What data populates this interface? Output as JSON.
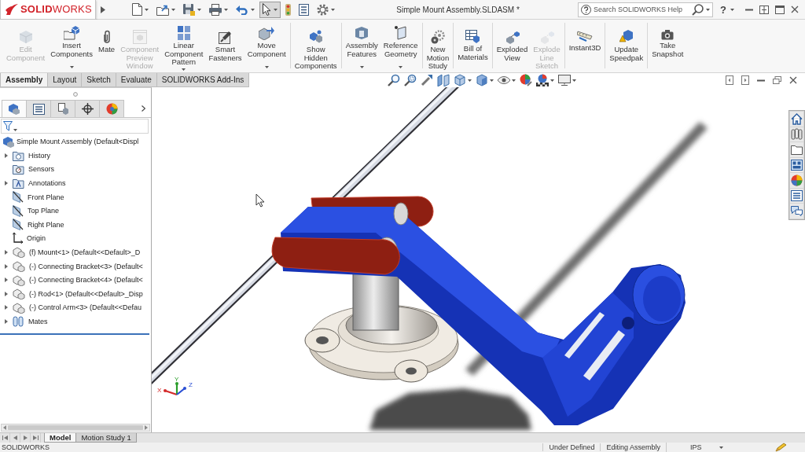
{
  "title_bar": {
    "logo": "**SOLID**WORKS",
    "quick_access": [
      {
        "dropdown": true,
        "selected": false
      },
      {
        "dropdown": true,
        "selected": false
      },
      {
        "dropdown": true,
        "selected": false
      },
      {
        "dropdown": true,
        "selected": false
      },
      {
        "dropdown": true,
        "selected": false
      },
      {
        "dropdown": true,
        "selected": true
      },
      {
        "dropdown": false,
        "selected": false
      },
      {
        "dropdown": false,
        "selected": false
      },
      {
        "dropdown": true,
        "selected": false
      }
    ],
    "title": "Simple Mount Assembly.SLDASM *",
    "search": {
      "placeholder": "Search SOLIDWORKS Help"
    },
    "help_menu": {
      "label": "?"
    }
  },
  "ribbon": {
    "groups": [
      {
        "buttons": [
          {
            "lines": [
              "Edit",
              "Component"
            ],
            "disabled": true,
            "dropdown": false
          },
          {
            "lines": [
              "Insert",
              "Components"
            ],
            "disabled": false,
            "dropdown": true
          },
          {
            "lines": [
              "Mate"
            ],
            "disabled": false,
            "dropdown": false
          },
          {
            "lines": [
              "Component",
              "Preview",
              "Window"
            ],
            "disabled": true,
            "dropdown": false
          },
          {
            "lines": [
              "Linear",
              "Component",
              "Pattern"
            ],
            "disabled": false,
            "dropdown": true
          },
          {
            "lines": [
              "Smart",
              "Fasteners"
            ],
            "disabled": false,
            "dropdown": false
          },
          {
            "lines": [
              "Move",
              "Component"
            ],
            "disabled": false,
            "dropdown": true
          }
        ]
      },
      {
        "buttons": [
          {
            "lines": [
              "Show",
              "Hidden",
              "Components"
            ],
            "disabled": false,
            "dropdown": false
          }
        ]
      },
      {
        "buttons": [
          {
            "lines": [
              "Assembly",
              "Features"
            ],
            "disabled": false,
            "dropdown": true
          },
          {
            "lines": [
              "Reference",
              "Geometry"
            ],
            "disabled": false,
            "dropdown": true
          }
        ]
      },
      {
        "buttons": [
          {
            "lines": [
              "New",
              "Motion",
              "Study"
            ],
            "disabled": false,
            "dropdown": false
          }
        ]
      },
      {
        "buttons": [
          {
            "lines": [
              "Bill of",
              "Materials"
            ],
            "disabled": false,
            "dropdown": false
          }
        ]
      },
      {
        "buttons": [
          {
            "lines": [
              "Exploded",
              "View"
            ],
            "disabled": false,
            "dropdown": false
          },
          {
            "lines": [
              "Explode",
              "Line",
              "Sketch"
            ],
            "disabled": true,
            "dropdown": false
          }
        ]
      },
      {
        "buttons": [
          {
            "lines": [
              "Instant3D"
            ],
            "disabled": false,
            "dropdown": false
          }
        ]
      },
      {
        "buttons": [
          {
            "lines": [
              "Update",
              "Speedpak"
            ],
            "disabled": false,
            "dropdown": false
          }
        ]
      },
      {
        "buttons": [
          {
            "lines": [
              "Take",
              "Snapshot"
            ],
            "disabled": false,
            "dropdown": false
          }
        ]
      }
    ]
  },
  "command_tabs": [
    {
      "label": "Assembly",
      "selected": true
    },
    {
      "label": "Layout",
      "selected": false
    },
    {
      "label": "Sketch",
      "selected": false
    },
    {
      "label": "Evaluate",
      "selected": false
    },
    {
      "label": "SOLIDWORKS Add-Ins",
      "selected": false
    }
  ],
  "view_toolbar": [
    {
      "dropdown": false
    },
    {
      "dropdown": false
    },
    {
      "dropdown": false
    },
    {
      "dropdown": false
    },
    {
      "dropdown": true
    },
    {
      "dropdown": true
    },
    {
      "dropdown": true
    },
    {
      "dropdown": false
    },
    {
      "dropdown": true
    },
    {
      "dropdown": true
    }
  ],
  "feature_manager": {
    "tabs": [
      {
        "selected": true
      },
      {
        "selected": false
      },
      {
        "selected": false
      },
      {
        "selected": false
      },
      {
        "selected": false
      }
    ],
    "tree": {
      "label": "Simple Mount Assembly (Default<Displ",
      "children": [
        {
          "label": "History",
          "kind": "history",
          "expandable": true
        },
        {
          "label": "Sensors",
          "kind": "sensors",
          "expandable": false
        },
        {
          "label": "Annotations",
          "kind": "annotations",
          "expandable": true
        },
        {
          "label": "Front Plane",
          "kind": "plane",
          "expandable": false
        },
        {
          "label": "Top Plane",
          "kind": "plane",
          "expandable": false
        },
        {
          "label": "Right Plane",
          "kind": "plane",
          "expandable": false
        },
        {
          "label": "Origin",
          "kind": "origin",
          "expandable": false
        },
        {
          "label": "(f) Mount<1> (Default<<Default>_D",
          "kind": "component",
          "expandable": true
        },
        {
          "label": "(-) Connecting Bracket<3> (Default<",
          "kind": "component",
          "expandable": true
        },
        {
          "label": "(-) Connecting Bracket<4> (Default<",
          "kind": "component",
          "expandable": true
        },
        {
          "label": "(-) Rod<1> (Default<<Default>_Disp",
          "kind": "component",
          "expandable": true
        },
        {
          "label": "(-) Control Arm<3> (Default<<Defau",
          "kind": "component",
          "expandable": true
        },
        {
          "label": "Mates",
          "kind": "mates",
          "expandable": true
        }
      ]
    }
  },
  "graphics": {
    "triad": [
      {
        "label": "X",
        "color": "#d42a2a"
      },
      {
        "label": "Y",
        "color": "#2a9d2a"
      },
      {
        "label": "Z",
        "color": "#2a4fd4"
      }
    ]
  },
  "bottom_tabs": [
    {
      "label": "Model",
      "selected": true
    },
    {
      "label": "Motion Study 1",
      "selected": false
    }
  ],
  "status_bar": {
    "app": "SOLIDWORKS",
    "fields": [
      "Under Defined",
      "Editing Assembly"
    ],
    "units": "IPS"
  }
}
